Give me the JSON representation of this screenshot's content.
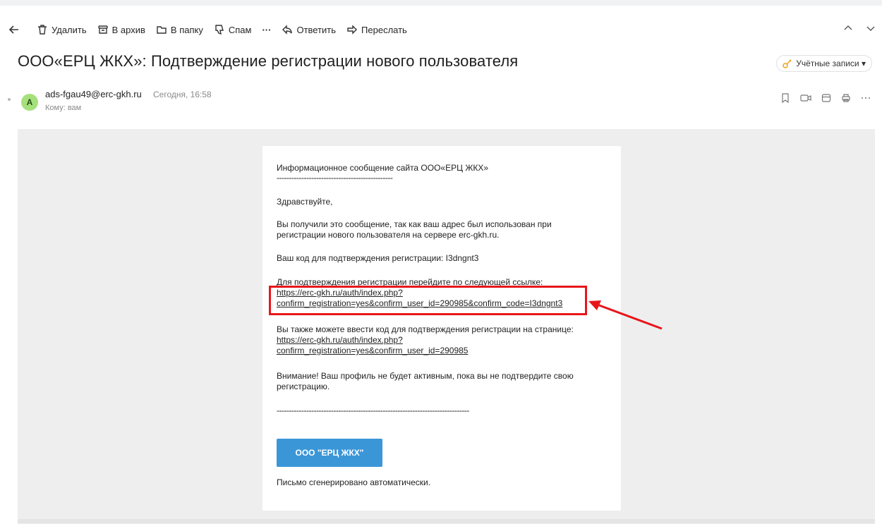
{
  "toolbar": {
    "delete": "Удалить",
    "archive": "В архив",
    "to_folder": "В папку",
    "spam": "Спам",
    "more": "···",
    "reply": "Ответить",
    "forward": "Переслать"
  },
  "subject": "ООО«ЕРЦ ЖКХ»: Подтверждение регистрации нового пользователя",
  "accounts_button": "Учётные записи ▾",
  "sender": {
    "avatar_letter": "A",
    "email": "ads-fgau49@erc-gkh.ru",
    "date": "Сегодня, 16:58",
    "to": "Кому: вам"
  },
  "letter": {
    "intro": "Информационное сообщение сайта ООО«ЕРЦ ЖКХ»",
    "dashes_short": "-----------------------------------------------",
    "greeting": "Здравствуйте,",
    "line1": "Вы получили это сообщение, так как ваш адрес был использован при",
    "line2": "регистрации нового пользователя на сервере erc-gkh.ru.",
    "code_line": "Ваш код для подтверждения регистрации: I3dngnt3",
    "confirm_line": "Для подтверждения регистрации перейдите по следующей ссылке:",
    "confirm_link_1": "https://erc-gkh.ru/auth/index.php?",
    "confirm_link_2": "confirm_registration=yes&confirm_user_id=290985&confirm_code=I3dngnt3",
    "alt_line": "Вы также можете ввести код для подтверждения регистрации на странице:",
    "alt_link_1": "https://erc-gkh.ru/auth/index.php?",
    "alt_link_2": "confirm_registration=yes&confirm_user_id=290985",
    "warning_1": "Внимание! Ваш профиль не будет активным, пока вы не подтвердите свою",
    "warning_2": "регистрацию.",
    "dashes_long": "------------------------------------------------------------------------------",
    "button": "ООО \"ЕРЦ ЖКХ\"",
    "footer": "Письмо сгенерировано автоматически."
  },
  "colors": {
    "link": "#2f7fc9",
    "highlight": "#e8161a",
    "button": "#3b96d8",
    "avatar": "#a5e07d"
  }
}
